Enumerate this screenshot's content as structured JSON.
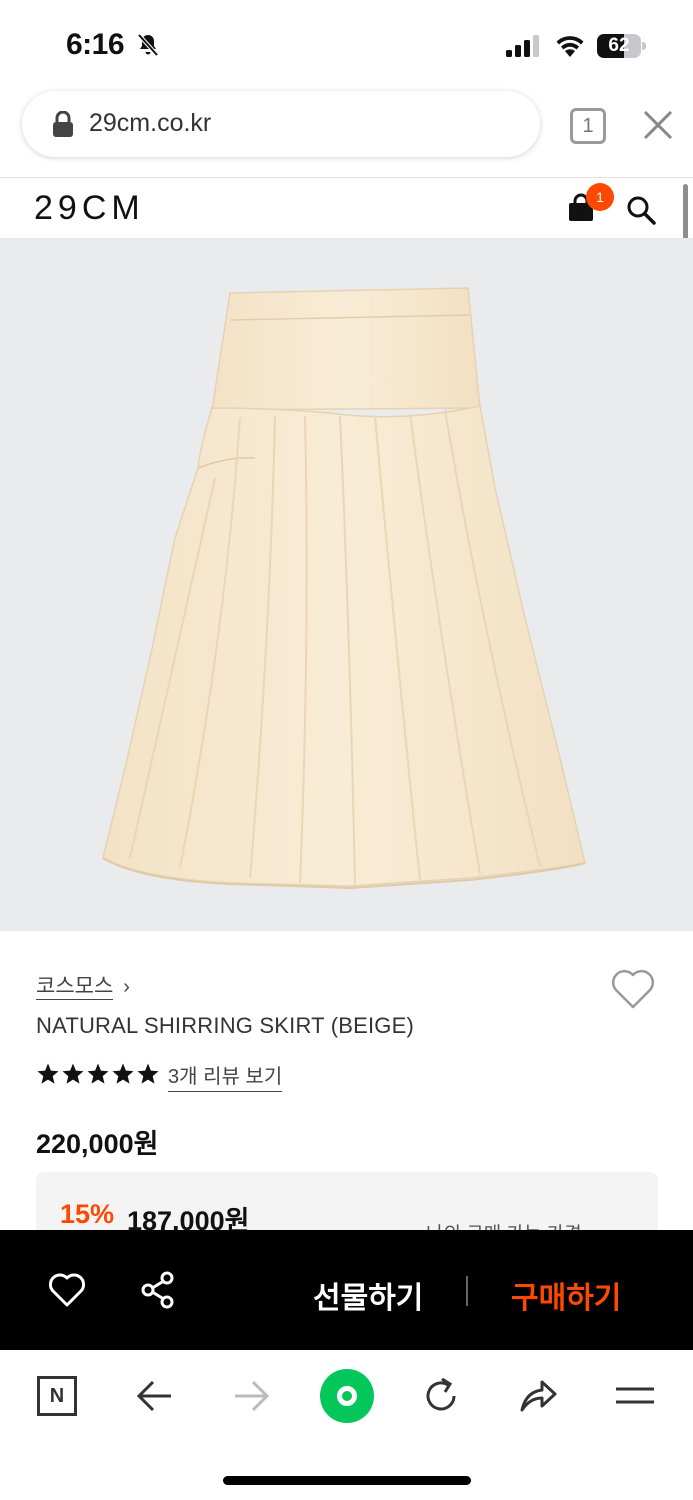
{
  "status_bar": {
    "time": "6:16",
    "battery": "62",
    "battery_level": 0.62
  },
  "browser": {
    "url": "29cm.co.kr",
    "tab_count": "1"
  },
  "site": {
    "logo": "29CM",
    "cart_count": "1"
  },
  "product": {
    "brand": "코스모스",
    "brand_chevron": "›",
    "name": "NATURAL SHIRRING SKIRT (BEIGE)",
    "rating": 5,
    "review_link": "3개 리뷰 보기",
    "price": "220,000원",
    "discount": "15%",
    "sale_price": "187,000원",
    "my_price_label": "나의 구매 가능 가격"
  },
  "purchase_bar": {
    "gift_label": "선물하기",
    "buy_label": "구매하기"
  },
  "colors": {
    "accent": "#ff4800",
    "naver_green": "#03c75a",
    "image_bg": "#eaebed",
    "skirt": "#f7e8cf"
  },
  "icons": [
    "bell-off-icon",
    "signal-icon",
    "wifi-icon",
    "lock-icon",
    "close-icon",
    "bag-icon",
    "search-icon",
    "heart-icon",
    "star-icon",
    "share-icon",
    "naver-n-icon",
    "back-icon",
    "forward-icon",
    "reload-icon",
    "share-arrow-icon",
    "menu-icon"
  ]
}
